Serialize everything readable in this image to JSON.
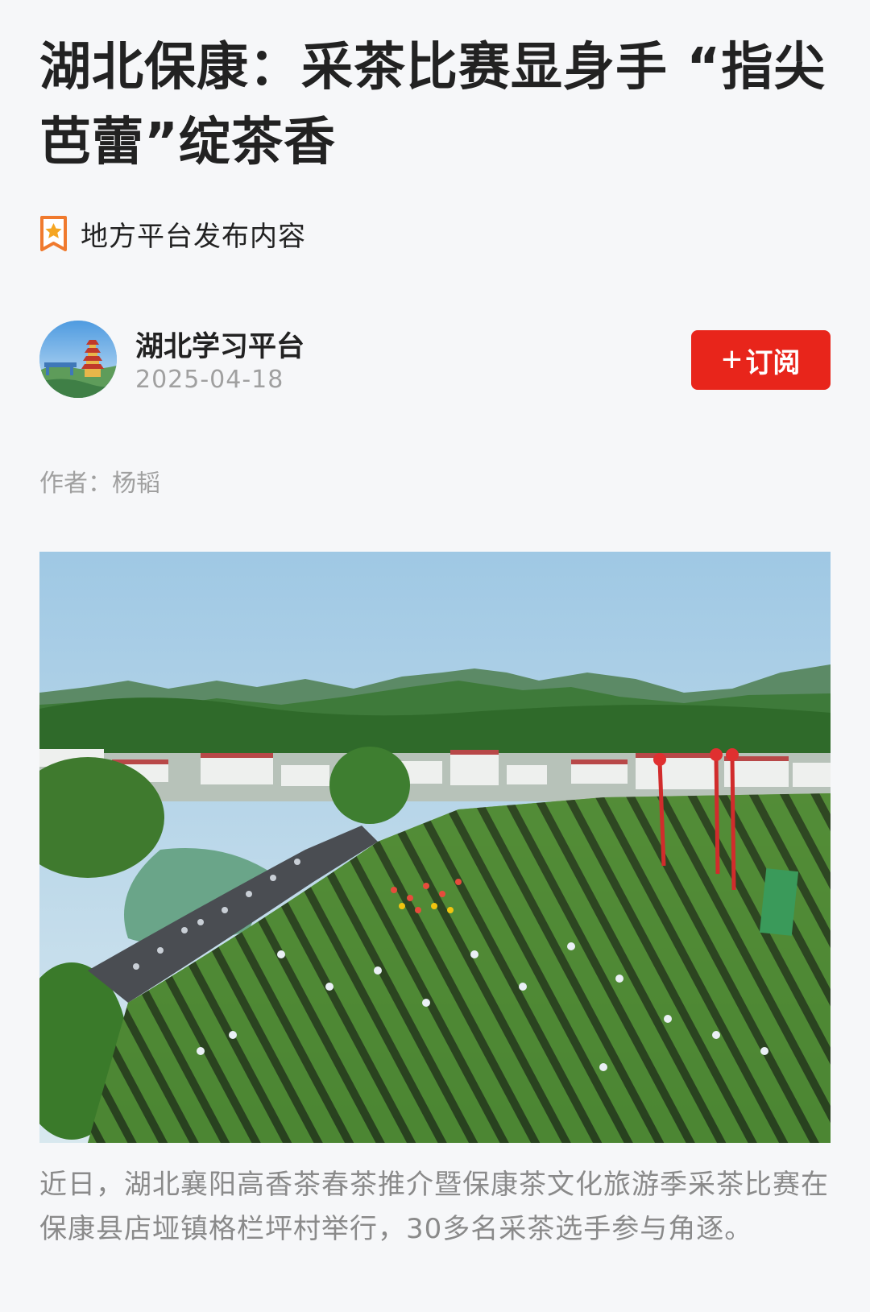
{
  "article": {
    "title": "湖北保康：采茶比赛显身手 “指尖芭蕾”绽茶香",
    "source_tag": "地方平台发布内容",
    "account_name": "湖北学习平台",
    "publish_date": "2025-04-18",
    "subscribe_label": "订阅",
    "subscribe_plus": "+",
    "author_line": "作者：杨韬",
    "caption": "近日，湖北襄阳高香茶春茶推介暨保康茶文化旅游季采茶比赛在保康县店垭镇格栏坪村举行，30多名采茶选手参与角逐。"
  },
  "colors": {
    "accent": "#e8251b",
    "tag_icon": "#f07a2e",
    "muted_text": "#a0a0a0",
    "background": "#f6f7f9"
  },
  "icons": {
    "source_tag": "bookmark-star-icon",
    "avatar": "yellow-crane-tower-avatar"
  }
}
